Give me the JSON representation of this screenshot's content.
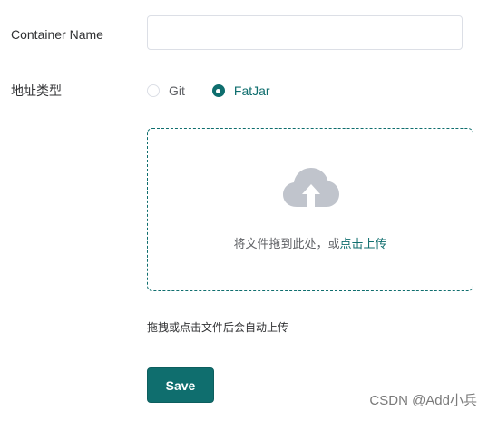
{
  "form": {
    "container_name": {
      "label": "Container Name",
      "value": "",
      "placeholder": ""
    },
    "address_type": {
      "label": "地址类型",
      "options": [
        {
          "label": "Git",
          "checked": false
        },
        {
          "label": "FatJar",
          "checked": true
        }
      ]
    },
    "upload": {
      "icon": "cloud-upload-icon",
      "text": "将文件拖到此处，或",
      "link": "点击上传",
      "tip": "拖拽或点击文件后会自动上传"
    },
    "save_label": "Save"
  },
  "watermark": "CSDN @Add小兵",
  "colors": {
    "accent": "#0f6e6e",
    "border": "#dcdfe6",
    "icon_gray": "#c0c4cc",
    "text": "#303133"
  }
}
